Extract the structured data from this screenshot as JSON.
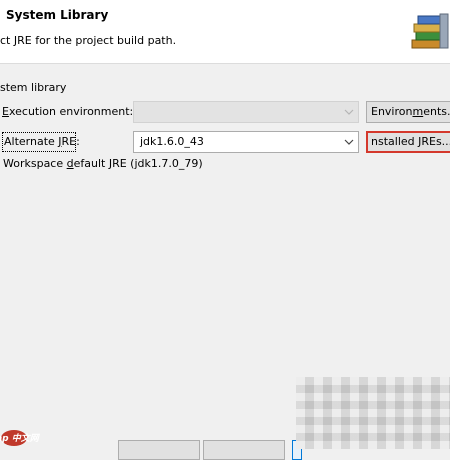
{
  "header": {
    "title": "System Library",
    "description": "ct JRE for the project build path."
  },
  "group": {
    "label": "stem library"
  },
  "execution": {
    "label_pre": "",
    "label_mn": "E",
    "label_post": "xecution environment:",
    "value": "",
    "button_pre": "Environ",
    "button_mn": "m",
    "button_post": "ents..."
  },
  "alternate": {
    "label_pre": "Alternate ",
    "label_mn": "J",
    "label_post": "RE:",
    "value": "jdk1.6.0_43",
    "button_label": "nstalled JREs..."
  },
  "workspace": {
    "pre": "Workspace ",
    "mn": "d",
    "post": "efault JRE (jdk1.7.0_79)"
  },
  "watermark": {
    "text": "php 中文网"
  },
  "colors": {
    "highlight": "#d4382c",
    "watermark": "#c0392b"
  }
}
